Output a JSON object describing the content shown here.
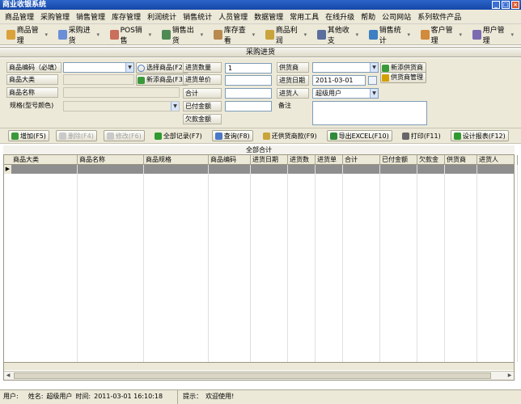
{
  "window": {
    "title": "商业收银系统"
  },
  "menu": [
    "商品管理",
    "采购管理",
    "销售管理",
    "库存管理",
    "利润统计",
    "销售统计",
    "人员管理",
    "数据管理",
    "常用工具",
    "在线升级",
    "帮助",
    "公司网站",
    "系列软件产品"
  ],
  "toolbar": [
    {
      "label": "商品管理",
      "icon": "box-icon",
      "color": "#d9a23a"
    },
    {
      "label": "采购进货",
      "icon": "cart-icon",
      "color": "#6b8fd6"
    },
    {
      "label": "POS销售",
      "icon": "pos-icon",
      "color": "#c96f5b"
    },
    {
      "label": "销售出货",
      "icon": "book-icon",
      "color": "#4f8a55"
    },
    {
      "label": "库存查看",
      "icon": "warehouse-icon",
      "color": "#b88a4e"
    },
    {
      "label": "商品利润",
      "icon": "coins-icon",
      "color": "#c9a43a"
    },
    {
      "label": "其他收支",
      "icon": "ledger-icon",
      "color": "#5b6f9e"
    },
    {
      "label": "销售统计",
      "icon": "chart-icon",
      "color": "#3c7fc2"
    },
    {
      "label": "客户管理",
      "icon": "customer-icon",
      "color": "#d28a3c"
    },
    {
      "label": "用户管理",
      "icon": "users-icon",
      "color": "#7c6bb0"
    }
  ],
  "section_title": "采购进货",
  "form": {
    "product_code_label": "商品编码（必填）",
    "category_label": "商品大类",
    "product_name_label": "商品名称",
    "spec_label": "规格(型号颜色)",
    "select_product": "选择商品(F2)",
    "new_product": "新添商品(F3)",
    "qty_label": "进货数量",
    "qty_value": "1",
    "unit_price_label": "进货单价",
    "total_label": "合计",
    "paid_label": "已付金额",
    "owed_label": "欠款金额",
    "supplier_label": "供货商",
    "date_label": "进货日期",
    "date_value": "2011-03-01",
    "buyer_label": "进货人",
    "buyer_value": "超级用户",
    "remark_label": "备注",
    "new_supplier": "新添供货商",
    "supplier_manage": "供货商管理"
  },
  "actions": [
    {
      "label": "增加(F5)",
      "name": "add-button",
      "enabled": true,
      "icon_color": "#3a9a3a"
    },
    {
      "label": "删除(F4)",
      "name": "delete-button",
      "enabled": false,
      "icon_color": "#c95050"
    },
    {
      "label": "修改(F6)",
      "name": "edit-button",
      "enabled": false,
      "icon_color": "#d4a000"
    },
    {
      "label": "全部记录(F7)",
      "name": "all-records-button",
      "enabled": true,
      "icon_color": "#2f9a2f",
      "flat": true
    },
    {
      "label": "查询(F8)",
      "name": "query-button",
      "enabled": true,
      "icon_color": "#4a78c8"
    },
    {
      "label": "还供货商款(F9)",
      "name": "repay-supplier-button",
      "enabled": true,
      "icon_color": "#c9a43a",
      "flat": true
    },
    {
      "label": "导出EXCEL(F10)",
      "name": "export-excel-button",
      "enabled": true,
      "icon_color": "#2f8a3a"
    },
    {
      "label": "打印(F11)",
      "name": "print-button",
      "enabled": true,
      "icon_color": "#666666",
      "flat": true
    },
    {
      "label": "设计报表(F12)",
      "name": "design-report-button",
      "enabled": true,
      "icon_color": "#2f9a2f"
    }
  ],
  "grid": {
    "title": "全部合计",
    "columns": [
      "商品大类",
      "商品名称",
      "商品规格",
      "商品编码",
      "进货日期",
      "进货数量",
      "进货单价",
      "合计",
      "已付金额",
      "欠款金额",
      "供货商",
      "进货人"
    ]
  },
  "status": {
    "user_label": "用户:",
    "name_label": "姓名:",
    "name_value": "超级用户",
    "time_label": "时间:",
    "time_value": "2011-03-01 16:10:18",
    "tip_label": "提示：",
    "tip_value": "欢迎使用!"
  }
}
